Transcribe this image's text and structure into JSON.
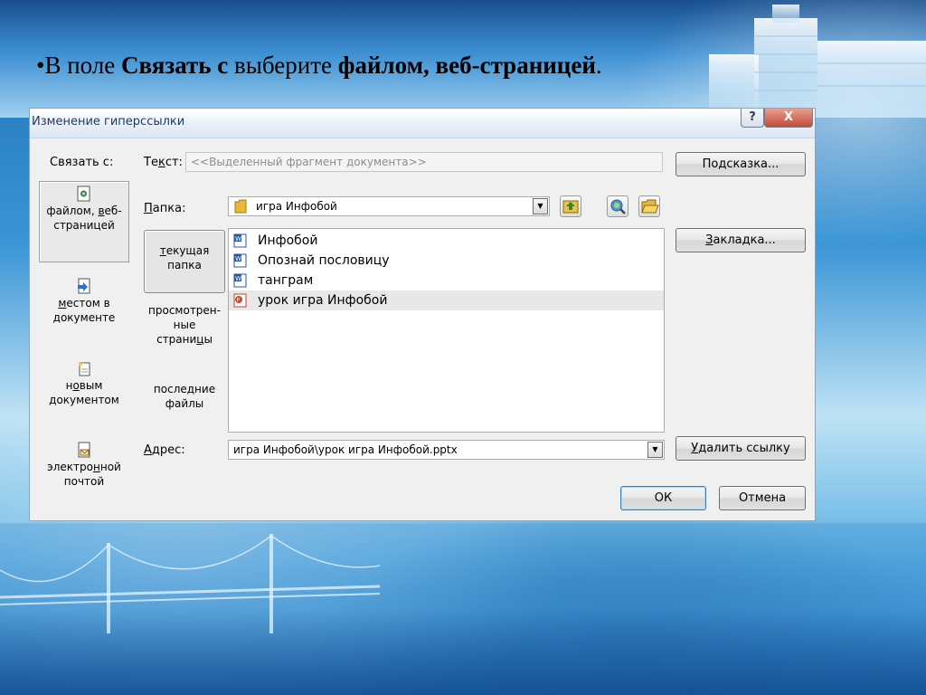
{
  "slide": {
    "bullet_marker": "•",
    "text_1": "В поле ",
    "bold_1": "Связать с",
    "text_2": " выберите ",
    "bold_2": "файлом, веб-страницей",
    "text_3": "."
  },
  "dialog": {
    "title": "Изменение гиперссылки",
    "help_label": "?",
    "close_label": "X",
    "link_to_label": "Связать с:",
    "link_options": [
      {
        "label_a": "файлом, ",
        "label_u": "в",
        "label_b": "еб-страницей",
        "icon": "web-page-icon",
        "active": true
      },
      {
        "label_u": "м",
        "label_b": "естом в документе",
        "icon": "place-in-document-icon",
        "active": false
      },
      {
        "label_a": "н",
        "label_u": "о",
        "label_b": "вым документом",
        "icon": "new-document-icon",
        "active": false
      },
      {
        "label_a": "электро",
        "label_u": "н",
        "label_b": "ной почтой",
        "icon": "email-icon",
        "active": false
      }
    ],
    "text_label_a": "Те",
    "text_label_u": "к",
    "text_label_b": "ст:",
    "text_value": "<<Выделенный фрагмент документа>>",
    "screentip_a": "По",
    "screentip_u": "д",
    "screentip_b": "сказка...",
    "folder_label_u": "П",
    "folder_label_b": "апка:",
    "folder_value": "игра Инфобой",
    "lookin": {
      "current_u": "т",
      "current_b": "екущая папка",
      "browsed_a": "просмотрен-ные страни",
      "browsed_u": "ц",
      "browsed_b": "ы",
      "recent_a": "после",
      "recent_u": "д",
      "recent_b": "ние файлы"
    },
    "files": [
      {
        "name": "Инфобой",
        "icon": "word-document-icon"
      },
      {
        "name": "Опознай пословицу",
        "icon": "word-document-icon"
      },
      {
        "name": "танграм",
        "icon": "word-document-icon"
      },
      {
        "name": "урок игра Инфобой",
        "icon": "powerpoint-file-icon"
      }
    ],
    "bookmark_u": "З",
    "bookmark_b": "акладка...",
    "address_label_u": "А",
    "address_label_b": "дрес:",
    "address_value": "игра Инфобой\\урок игра Инфобой.pptx",
    "remove_link_u": "У",
    "remove_link_b": "далить ссылку",
    "ok_label": "ОК",
    "cancel_label": "Отмена"
  },
  "colors": {
    "dialog_bg": "#f0f0f0",
    "title_text": "#1e395b",
    "close_red": "#c44b35"
  }
}
